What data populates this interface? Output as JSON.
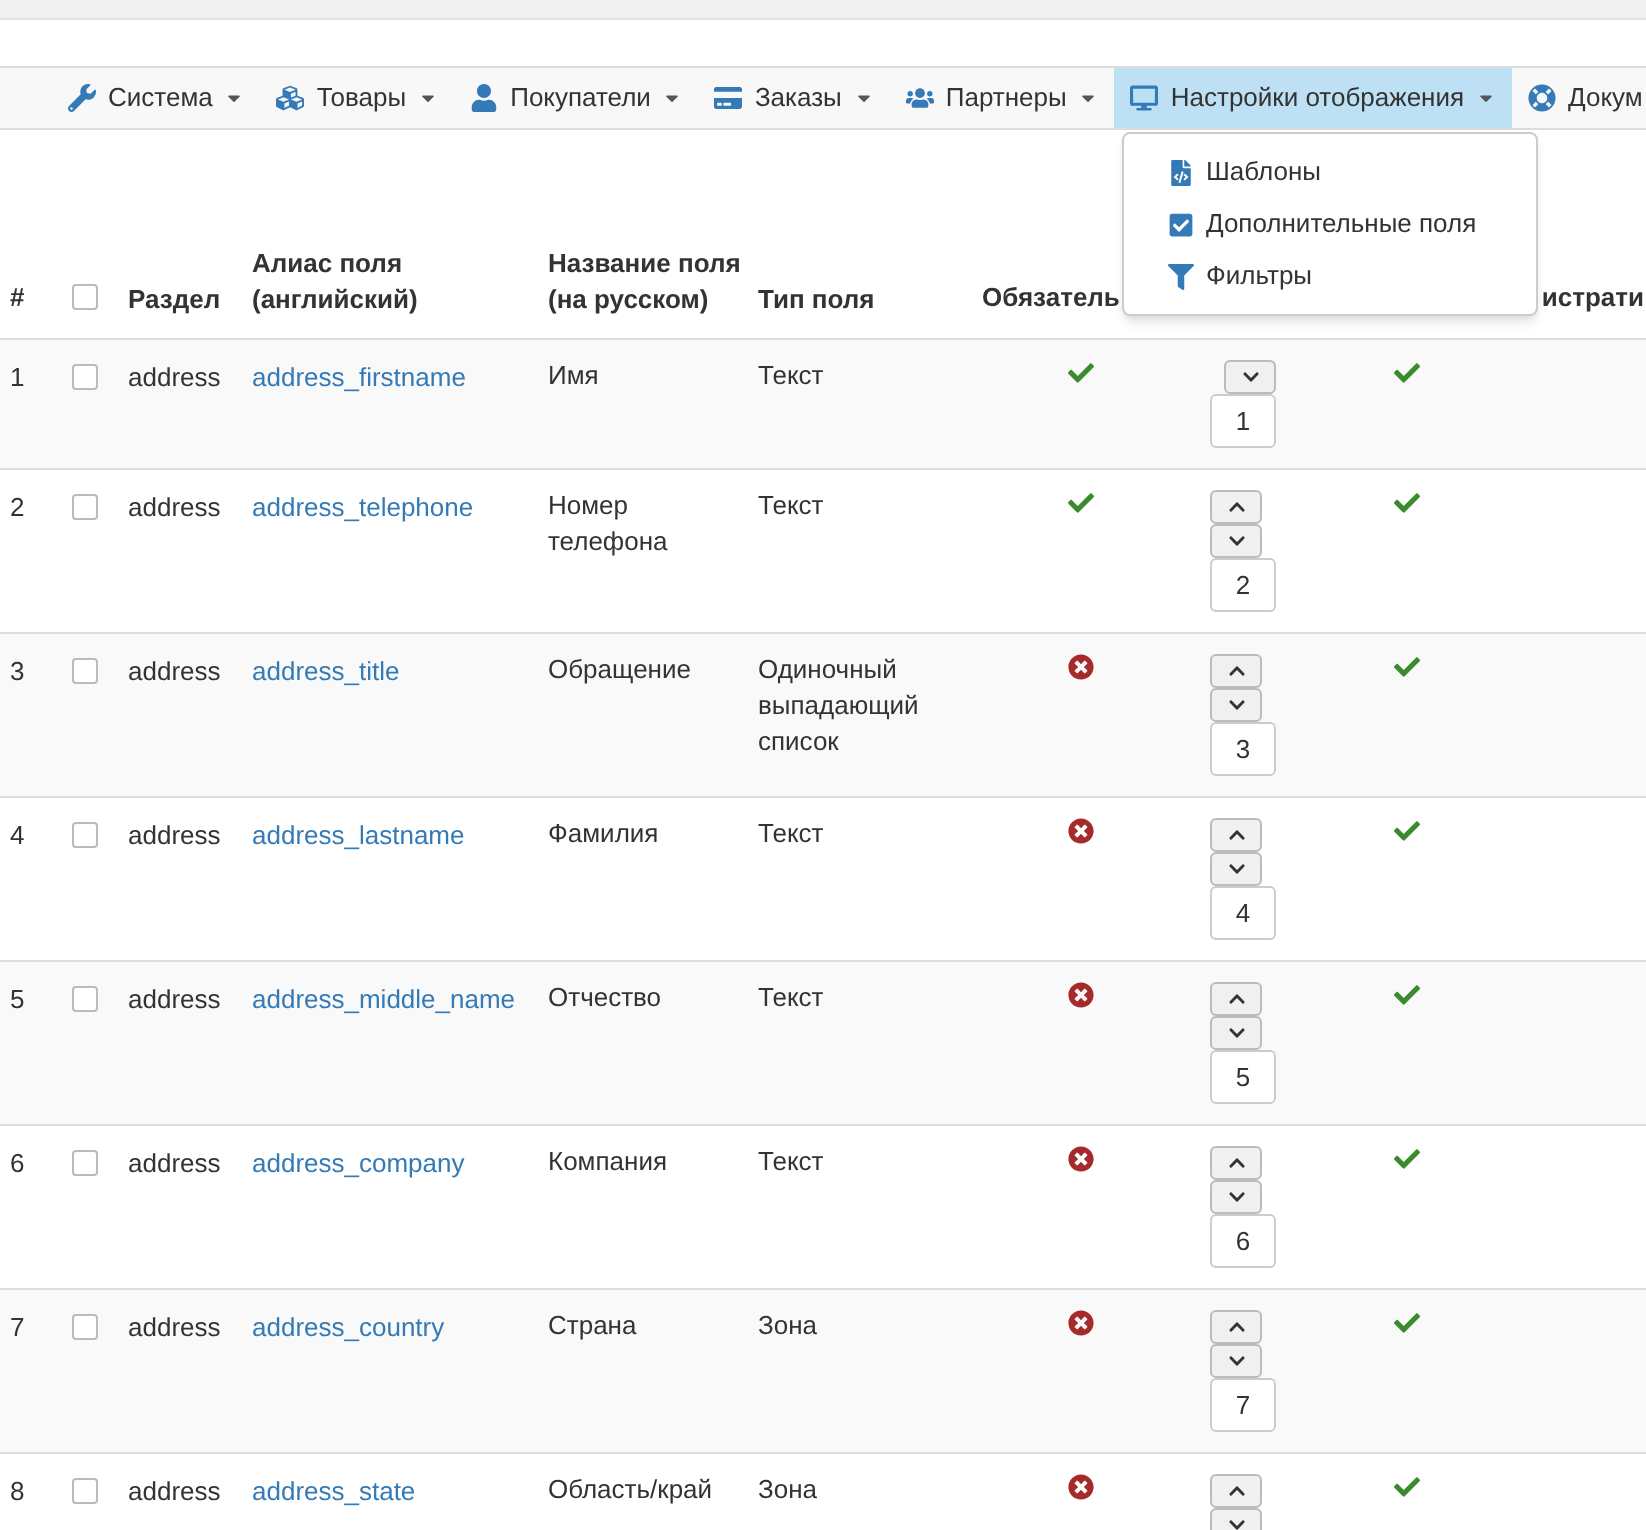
{
  "menu": [
    {
      "label": "Система",
      "selected": false
    },
    {
      "label": "Товары",
      "selected": false
    },
    {
      "label": "Покупатели",
      "selected": false
    },
    {
      "label": "Заказы",
      "selected": false
    },
    {
      "label": "Партнеры",
      "selected": false
    },
    {
      "label": "Настройки отображения",
      "selected": true
    },
    {
      "label": "Докум",
      "selected": false
    }
  ],
  "dropdown": [
    {
      "label": "Шаблоны"
    },
    {
      "label": "Дополнительные поля"
    },
    {
      "label": "Фильтры"
    }
  ],
  "table": {
    "select_all_checked": false,
    "columns": [
      "#",
      "Раздел",
      "Алиас поля (английский)",
      "Название поля (на русском)",
      "Тип поля",
      "Обязатель",
      "истрати"
    ],
    "rows": [
      {
        "num": "1",
        "checked": false,
        "section": "address",
        "alias": "address_firstname",
        "name": "Имя",
        "type": "Текст",
        "required": true,
        "up": false,
        "down": true,
        "order": "1",
        "admin": true
      },
      {
        "num": "2",
        "checked": false,
        "section": "address",
        "alias": "address_telephone",
        "name": "Номер телефона",
        "type": "Текст",
        "required": true,
        "up": true,
        "down": true,
        "order": "2",
        "admin": true
      },
      {
        "num": "3",
        "checked": false,
        "section": "address",
        "alias": "address_title",
        "name": "Обращение",
        "type": "Одиночный выпадающий список",
        "required": false,
        "up": true,
        "down": true,
        "order": "3",
        "admin": true
      },
      {
        "num": "4",
        "checked": false,
        "section": "address",
        "alias": "address_lastname",
        "name": "Фамилия",
        "type": "Текст",
        "required": false,
        "up": true,
        "down": true,
        "order": "4",
        "admin": true
      },
      {
        "num": "5",
        "checked": false,
        "section": "address",
        "alias": "address_middle_name",
        "name": "Отчество",
        "type": "Текст",
        "required": false,
        "up": true,
        "down": true,
        "order": "5",
        "admin": true
      },
      {
        "num": "6",
        "checked": false,
        "section": "address",
        "alias": "address_company",
        "name": "Компания",
        "type": "Текст",
        "required": false,
        "up": true,
        "down": true,
        "order": "6",
        "admin": true
      },
      {
        "num": "7",
        "checked": false,
        "section": "address",
        "alias": "address_country",
        "name": "Страна",
        "type": "Зона",
        "required": false,
        "up": true,
        "down": true,
        "order": "7",
        "admin": true
      },
      {
        "num": "8",
        "checked": false,
        "section": "address",
        "alias": "address_state",
        "name": "Область/край",
        "type": "Зона",
        "required": false,
        "up": true,
        "down": true,
        "admin": true
      }
    ]
  }
}
